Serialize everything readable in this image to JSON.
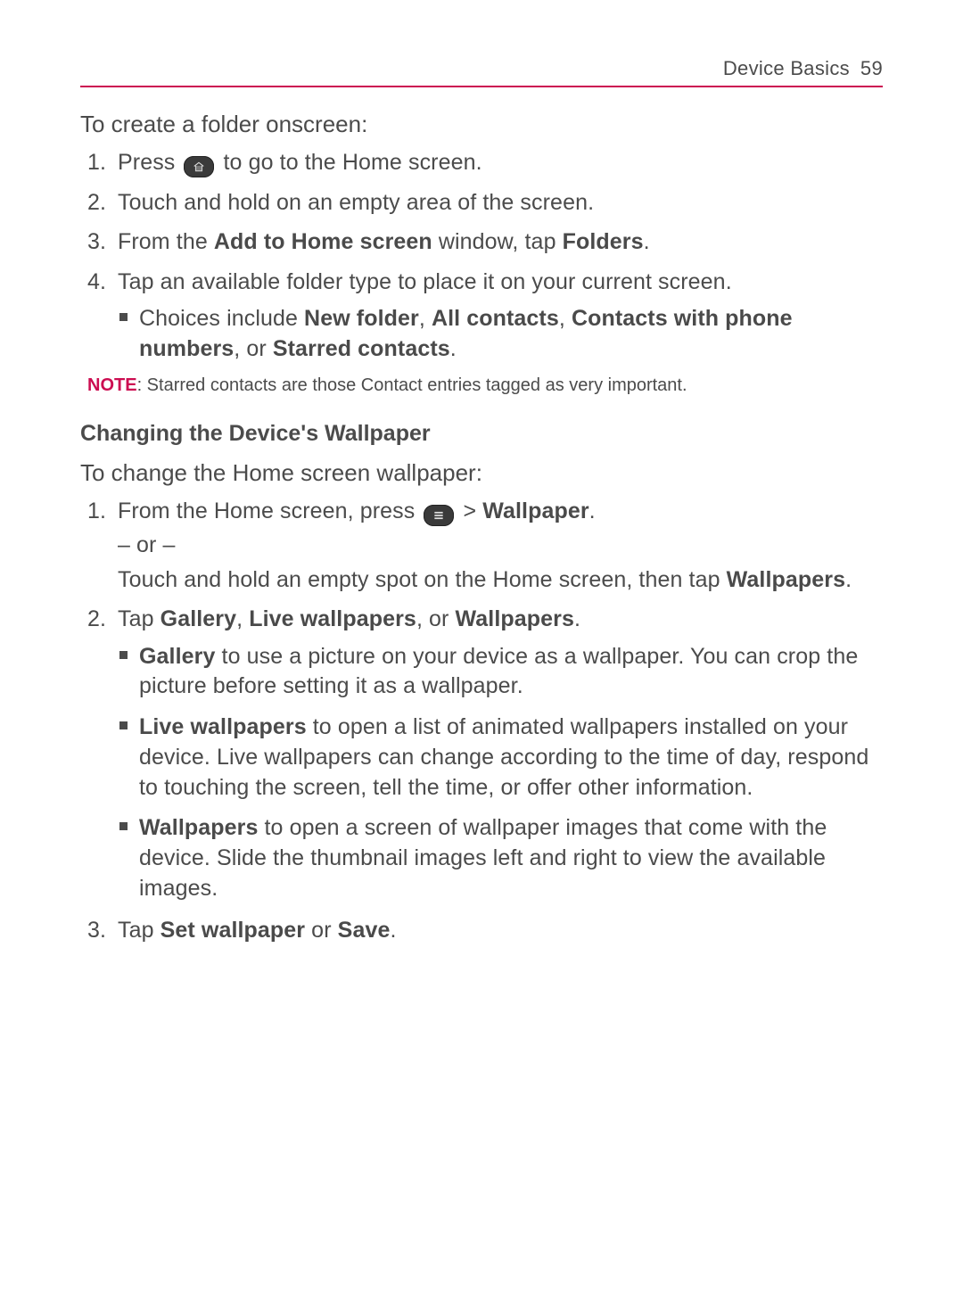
{
  "header": {
    "section": "Device Basics",
    "page": "59"
  },
  "s1": {
    "title": "To create a folder onscreen:",
    "steps": [
      {
        "num": "1.",
        "parts": [
          "Press ",
          "HOME_ICON",
          " to go to the Home screen."
        ]
      },
      {
        "num": "2.",
        "parts": [
          "Touch and hold on an empty area of the screen."
        ]
      },
      {
        "num": "3.",
        "parts": [
          "From the ",
          {
            "b": "Add to Home screen"
          },
          " window, tap ",
          {
            "b": "Folders"
          },
          "."
        ]
      },
      {
        "num": "4.",
        "parts": [
          "Tap an available folder type to place it on your current screen."
        ],
        "bullets": [
          {
            "parts": [
              "Choices include ",
              {
                "b": "New folder"
              },
              ", ",
              {
                "b": "All contacts"
              },
              ", ",
              {
                "b": "Contacts with phone numbers"
              },
              ", or ",
              {
                "b": "Starred contacts"
              },
              "."
            ]
          }
        ]
      }
    ],
    "note": {
      "label": "NOTE",
      "text": ": Starred contacts are those Contact entries tagged as very important."
    }
  },
  "s2": {
    "heading": "Changing the Device's Wallpaper",
    "title": "To change the Home screen wallpaper:",
    "steps": [
      {
        "num": "1.",
        "parts": [
          "From the Home screen, press ",
          "MENU_ICON",
          " > ",
          {
            "b": "Wallpaper"
          },
          "."
        ],
        "cont": [
          {
            "parts": [
              "– or –"
            ]
          },
          {
            "parts": [
              "Touch and hold an empty spot on the Home screen, then tap ",
              {
                "b": "Wallpapers"
              },
              "."
            ]
          }
        ]
      },
      {
        "num": "2.",
        "parts": [
          "Tap ",
          {
            "b": "Gallery"
          },
          ", ",
          {
            "b": "Live wallpapers"
          },
          ", or ",
          {
            "b": "Wallpapers"
          },
          "."
        ],
        "bullets": [
          {
            "parts": [
              {
                "b": "Gallery"
              },
              " to use a picture on your device as a wallpaper. You can crop the picture before setting it as a wallpaper."
            ]
          },
          {
            "parts": [
              {
                "b": "Live wallpapers"
              },
              " to open a list of animated wallpapers installed on your device. Live wallpapers can change according to the time of day, respond to touching the screen, tell the time, or offer other information."
            ]
          },
          {
            "parts": [
              {
                "b": "Wallpapers"
              },
              " to open a screen of wallpaper images that come with the device. Slide the thumbnail images left and right to view the available images."
            ]
          }
        ]
      },
      {
        "num": "3.",
        "parts": [
          "Tap ",
          {
            "b": "Set wallpaper"
          },
          " or ",
          {
            "b": "Save"
          },
          "."
        ]
      }
    ]
  }
}
